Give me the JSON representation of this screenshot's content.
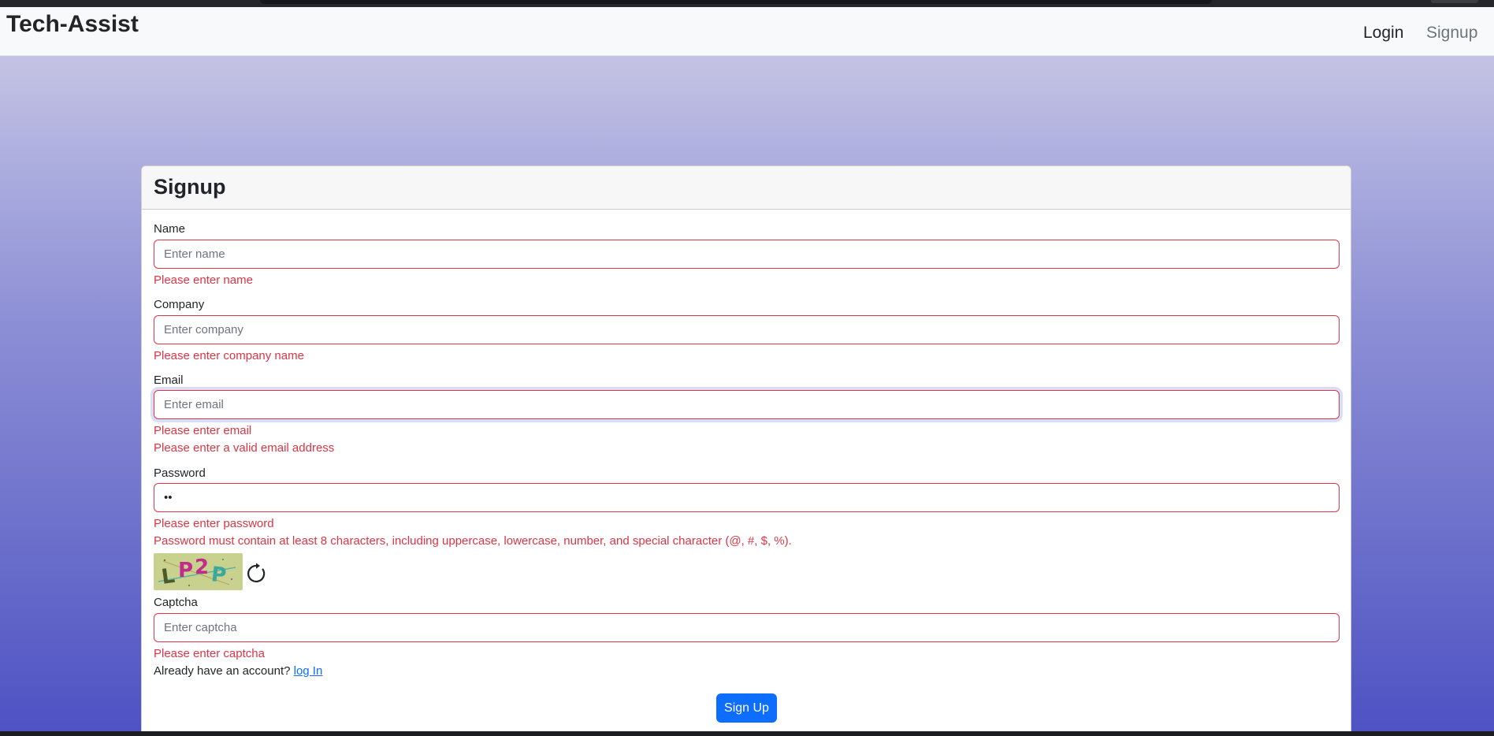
{
  "app": {
    "brand": "Tech-Assist",
    "nav": {
      "login": "Login",
      "signup": "Signup"
    }
  },
  "form": {
    "title": "Signup",
    "name": {
      "label": "Name",
      "placeholder": "Enter name",
      "value": "",
      "error": "Please enter name"
    },
    "company": {
      "label": "Company",
      "placeholder": "Enter company",
      "value": "",
      "error": "Please enter company name"
    },
    "email": {
      "label": "Email",
      "placeholder": "Enter email",
      "value": "",
      "errors": [
        "Please enter email",
        "Please enter a valid email address"
      ]
    },
    "password": {
      "label": "Password",
      "value": "••",
      "errors": [
        "Please enter password",
        "Password must contain at least 8 characters, including uppercase, lowercase, number, and special character (@, #, $, %)."
      ]
    },
    "captcha": {
      "image_text": "LP2P",
      "refresh_icon": "refresh-icon",
      "label": "Captcha",
      "placeholder": "Enter captcha",
      "value": "",
      "error": "Please enter captcha"
    },
    "login_prompt": "Already have an account?",
    "login_link": "log In",
    "submit": "Sign Up"
  },
  "colors": {
    "error": "#dc3545",
    "primary": "#0d6efd",
    "gradient_top": "#c4c3e3",
    "gradient_bottom": "#4e52c3"
  }
}
